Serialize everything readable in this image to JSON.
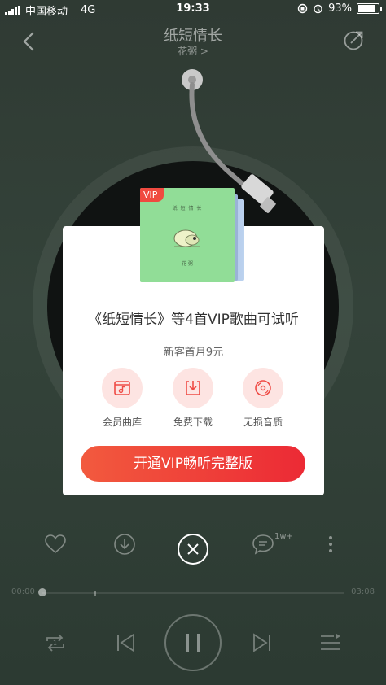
{
  "status_bar": {
    "carrier": "中国移动",
    "network": "4G",
    "time": "19:33",
    "battery": "93%"
  },
  "header": {
    "title": "纸短情长",
    "artist": "花粥 >"
  },
  "dialog": {
    "cover": {
      "vip_tag": "VIP",
      "title": "纸 短 情 长",
      "artist": "花 粥"
    },
    "title": "《纸短情长》等4首VIP歌曲可试听",
    "offer": "新客首月9元",
    "features": [
      {
        "label": "会员曲库",
        "icon": "music-library-icon"
      },
      {
        "label": "免费下载",
        "icon": "download-icon"
      },
      {
        "label": "无损音质",
        "icon": "lossless-disc-icon"
      }
    ],
    "cta": "开通VIP畅听完整版"
  },
  "player": {
    "comment_count": "1w+",
    "time_current": "00:00",
    "time_total": "03:08",
    "progress": 0.0
  },
  "colors": {
    "accent": "#ec2a35",
    "background": "#34433a",
    "vip_cover": "#91dd97"
  }
}
